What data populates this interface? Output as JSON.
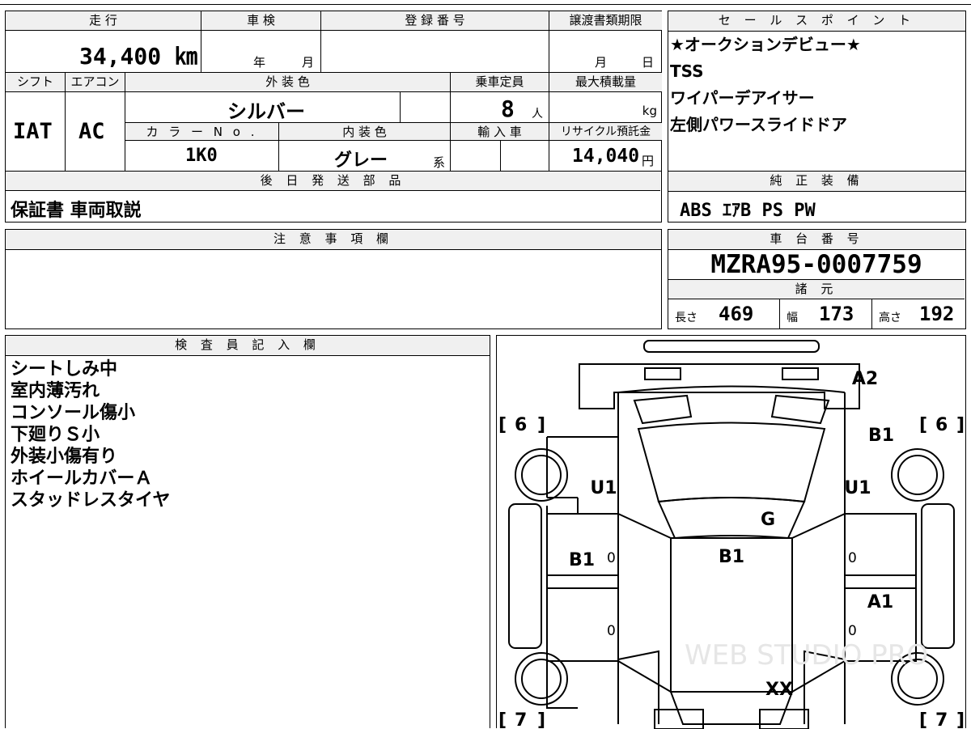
{
  "basic": {
    "labels": {
      "mileage": "走 行",
      "inspection": "車 検",
      "reg_number": "登 録 番 号",
      "transfer_deadline": "譲渡書類期限",
      "shift": "シフト",
      "aircon": "エアコン",
      "exterior_color": "外 装 色",
      "capacity": "乗車定員",
      "max_load": "最大積載量",
      "color_no": "カ ラ ー N o .",
      "interior_color": "内 装 色",
      "import": "輸 入 車",
      "recycle_fee": "リサイクル預託金"
    },
    "mileage_value": "34,400 ㎞",
    "inspection_year_unit": "年",
    "inspection_month_unit": "月",
    "deadline_month_unit": "月",
    "deadline_day_unit": "日",
    "shift_value": "IAT",
    "aircon_value": "AC",
    "exterior_color_value": "シルバー",
    "capacity_value": "8",
    "capacity_unit": "人",
    "max_load_unit": "kg",
    "color_no_value": "1K0",
    "interior_color_value": "グレー",
    "interior_suffix": "系",
    "recycle_fee_value": "14,040",
    "recycle_fee_unit": "円"
  },
  "later_parts": {
    "title": "後 日 発 送 部 品",
    "value": "保証書 車両取説"
  },
  "sales_points": {
    "title": "セ ー ル ス ポ イ ン ト",
    "items": [
      "★オークションデビュー★",
      "TSS",
      "ワイパーデアイサー",
      "左側パワースライドドア"
    ]
  },
  "equipment": {
    "title": "純 正 装 備",
    "value": "ABS ｴｱB PS PW"
  },
  "notes": {
    "title": "注 意 事 項 欄"
  },
  "chassis": {
    "title": "車 台 番 号",
    "value": "MZRA95-0007759"
  },
  "specs": {
    "title": "諸 元",
    "length_label": "長さ",
    "length_value": "469",
    "width_label": "幅",
    "width_value": "173",
    "height_label": "高さ",
    "height_value": "192"
  },
  "inspector": {
    "title": "検 査 員 記 入 欄",
    "lines": [
      "シートしみ中",
      "室内薄汚れ",
      "コンソール傷小",
      "下廻りＳ小",
      "外装小傷有り",
      "ホイールカバーＡ",
      "スタッドレスタイヤ"
    ]
  },
  "diagram": {
    "marks": {
      "rear_hatch": "A2",
      "right_rear_quarter": "B1",
      "left_rear_quarter": "U1",
      "right_quarter_lower": "U1",
      "roof": "G",
      "left_rear_door": "B1",
      "roof_center": "B1",
      "right_front_door": "A1",
      "hood": "XX"
    },
    "tire_labels": {
      "rear_left": "6",
      "rear_right": "6",
      "front_left": "7",
      "front_right": "7"
    },
    "door_zeros": "0",
    "watermark": "WEB STUDIO PRO"
  }
}
